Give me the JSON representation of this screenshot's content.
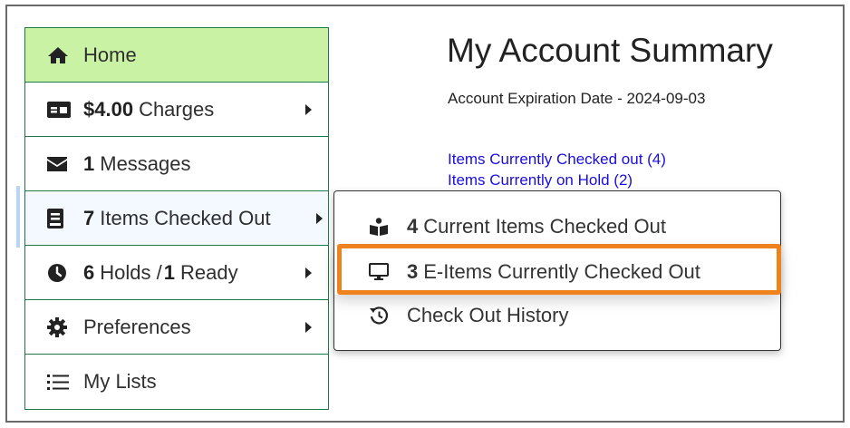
{
  "sidebar": {
    "items": [
      {
        "label": "Home",
        "bold": "",
        "icon": "home-icon"
      },
      {
        "label": "Charges",
        "bold": "$4.00",
        "icon": "money-bill-icon"
      },
      {
        "label": "Messages",
        "bold": "1",
        "icon": "envelope-icon"
      },
      {
        "label": "Items Checked Out",
        "bold": "7",
        "icon": "book-icon"
      },
      {
        "label": "Holds / ",
        "bold": "6",
        "bold2": "1",
        "label2": "Ready",
        "icon": "clock-icon"
      },
      {
        "label": "Preferences",
        "bold": "",
        "icon": "gear-icon"
      },
      {
        "label": "My Lists",
        "bold": "",
        "icon": "list-icon"
      }
    ]
  },
  "main": {
    "title": "My Account Summary",
    "expiration": "Account Expiration Date - 2024-09-03",
    "links": [
      "Items Currently Checked out (4)",
      "Items Currently on Hold (2)"
    ]
  },
  "dropdown": {
    "items": [
      {
        "count": "4",
        "label": "Current Items Checked Out",
        "icon": "reader-icon"
      },
      {
        "count": "3",
        "label": "E-Items Currently Checked Out",
        "icon": "desktop-icon"
      },
      {
        "count": "",
        "label": "Check Out History",
        "icon": "history-icon"
      }
    ]
  },
  "colors": {
    "sidebar_border": "#1e7a45",
    "active_bg": "#c9f2a5",
    "link": "#1a0dde",
    "highlight": "#f0821e"
  }
}
